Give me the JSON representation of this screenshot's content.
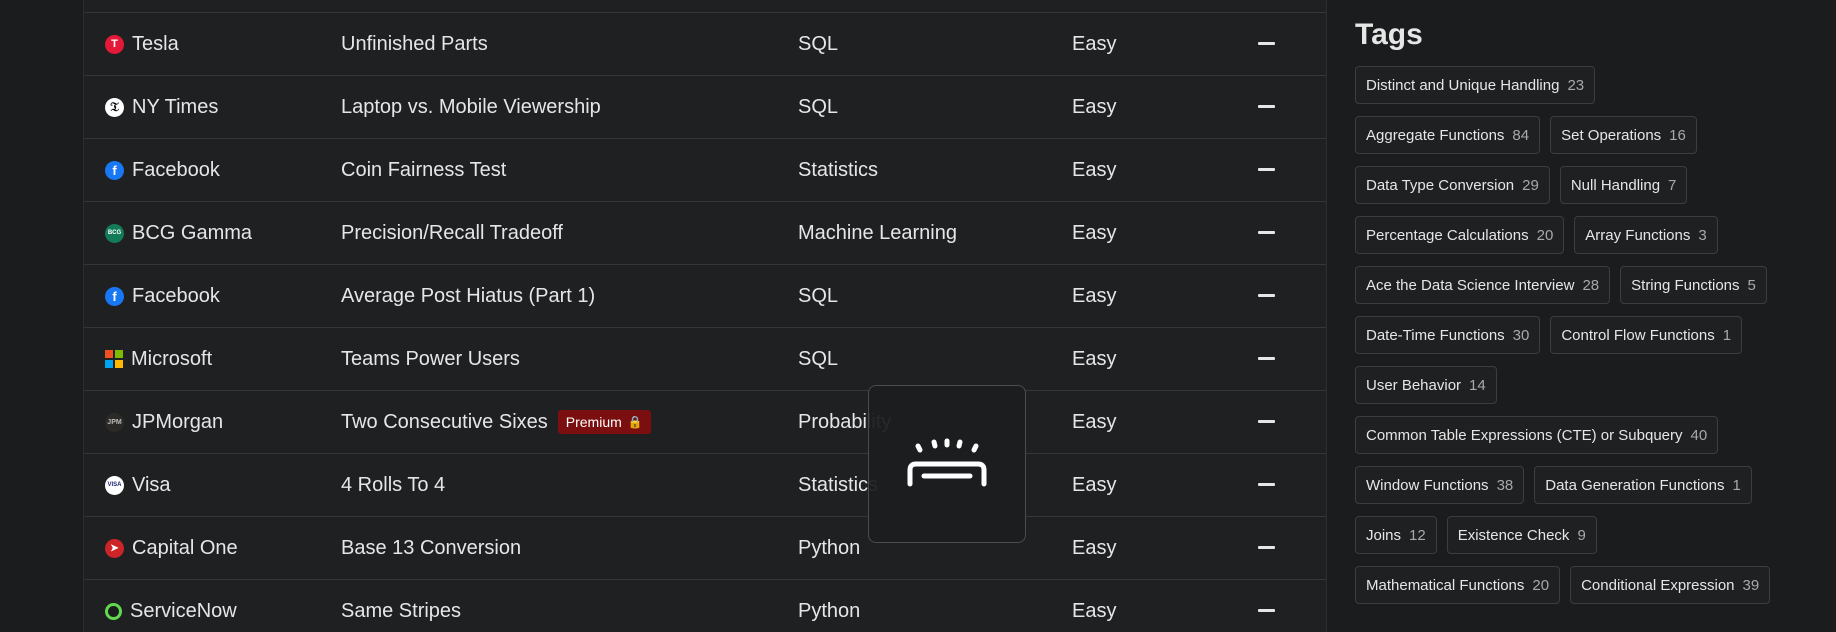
{
  "rows": [
    {
      "company": "Tesla",
      "logo": "tesla-icon",
      "title": "Unfinished Parts",
      "category": "SQL",
      "difficulty": "Easy"
    },
    {
      "company": "NY Times",
      "logo": "nytimes-icon",
      "title": "Laptop vs. Mobile Viewership",
      "category": "SQL",
      "difficulty": "Easy"
    },
    {
      "company": "Facebook",
      "logo": "facebook-icon",
      "title": "Coin Fairness Test",
      "category": "Statistics",
      "difficulty": "Easy"
    },
    {
      "company": "BCG Gamma",
      "logo": "bcg-icon",
      "title": "Precision/Recall Tradeoff",
      "category": "Machine Learning",
      "difficulty": "Easy"
    },
    {
      "company": "Facebook",
      "logo": "facebook-icon",
      "title": "Average Post Hiatus (Part 1)",
      "category": "SQL",
      "difficulty": "Easy"
    },
    {
      "company": "Microsoft",
      "logo": "microsoft-icon",
      "title": "Teams Power Users",
      "category": "SQL",
      "difficulty": "Easy"
    },
    {
      "company": "JPMorgan",
      "logo": "jpmorgan-icon",
      "title": "Two Consecutive Sixes",
      "category": "Probability",
      "difficulty": "Easy",
      "premium": "Premium"
    },
    {
      "company": "Visa",
      "logo": "visa-icon",
      "title": "4 Rolls To 4",
      "category": "Statistics",
      "difficulty": "Easy"
    },
    {
      "company": "Capital One",
      "logo": "capital-one-icon",
      "title": "Base 13 Conversion",
      "category": "Python",
      "difficulty": "Easy"
    },
    {
      "company": "ServiceNow",
      "logo": "servicenow-icon",
      "title": "Same Stripes",
      "category": "Python",
      "difficulty": "Easy"
    }
  ],
  "tags": {
    "heading": "Tags",
    "items": [
      {
        "label": "Distinct and Unique Handling",
        "count": "23"
      },
      {
        "label": "Aggregate Functions",
        "count": "84"
      },
      {
        "label": "Set Operations",
        "count": "16"
      },
      {
        "label": "Data Type Conversion",
        "count": "29"
      },
      {
        "label": "Null Handling",
        "count": "7"
      },
      {
        "label": "Percentage Calculations",
        "count": "20"
      },
      {
        "label": "Array Functions",
        "count": "3"
      },
      {
        "label": "Ace the Data Science Interview",
        "count": "28"
      },
      {
        "label": "String Functions",
        "count": "5"
      },
      {
        "label": "Date-Time Functions",
        "count": "30"
      },
      {
        "label": "Control Flow Functions",
        "count": "1"
      },
      {
        "label": "User Behavior",
        "count": "14"
      },
      {
        "label": "Common Table Expressions (CTE) or Subquery",
        "count": "40"
      },
      {
        "label": "Window Functions",
        "count": "38"
      },
      {
        "label": "Data Generation Functions",
        "count": "1"
      },
      {
        "label": "Joins",
        "count": "12"
      },
      {
        "label": "Existence Check",
        "count": "9"
      },
      {
        "label": "Mathematical Functions",
        "count": "20"
      },
      {
        "label": "Conditional Expression",
        "count": "39"
      }
    ]
  },
  "overlay": {
    "icon": "keyboard-backlight-icon"
  }
}
